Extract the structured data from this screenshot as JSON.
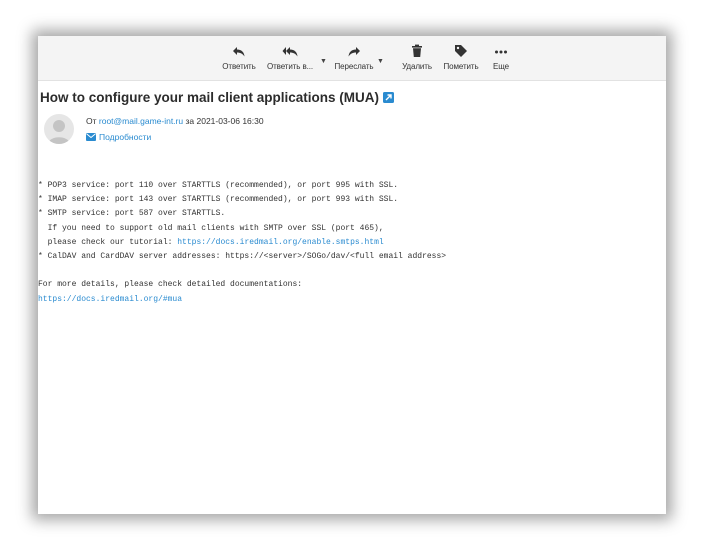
{
  "toolbar": {
    "reply": "Ответить",
    "reply_all": "Ответить в...",
    "forward": "Переслать",
    "delete": "Удалить",
    "mark": "Пометить",
    "more": "Еще"
  },
  "message": {
    "subject": "How to configure your mail client applications (MUA)",
    "from_label": "От",
    "from_email": "root@mail.game-int.ru",
    "date_prefix": "за",
    "date": "2021-03-06 16:30",
    "details_label": "Подробности"
  },
  "body": {
    "line1": "* POP3 service: port 110 over STARTTLS (recommended), or port 995 with SSL.",
    "line2": "* IMAP service: port 143 over STARTTLS (recommended), or port 993 with SSL.",
    "line3": "* SMTP service: port 587 over STARTTLS.",
    "line4": "  If you need to support old mail clients with SMTP over SSL (port 465),",
    "line5_text": "  please check our tutorial: ",
    "line5_link": "https://docs.iredmail.org/enable.smtps.html",
    "line6": "* CalDAV and CardDAV server addresses: https://<server>/SOGo/dav/<full email address>",
    "line7": "For more details, please check detailed documentations:",
    "line8_link": "https://docs.iredmail.org/#mua"
  },
  "colors": {
    "link": "#2a8bd0",
    "toolbar_bg": "#f4f4f4",
    "text": "#333333"
  }
}
